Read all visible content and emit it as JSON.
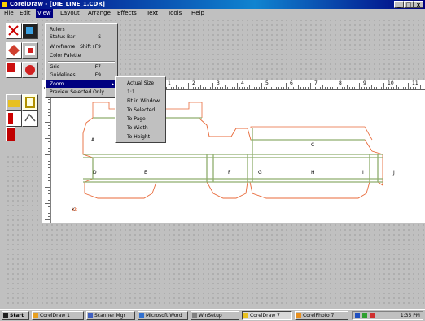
{
  "window": {
    "title": "CorelDraw - [DIE_LINE_1.CDR]",
    "min_label": "_",
    "max_label": "□",
    "close_label": "x"
  },
  "menubar": {
    "items": [
      "File",
      "Edit",
      "View",
      "Layout",
      "Arrange",
      "Effects",
      "Text",
      "Tools",
      "Help"
    ],
    "active_index": 2
  },
  "view_menu": {
    "items": [
      {
        "label": "Rulers",
        "shortcut": ""
      },
      {
        "label": "Status Bar",
        "shortcut": "S"
      },
      {
        "label": "Wireframe",
        "shortcut": "Shift+F9"
      },
      {
        "label": "Color Palette",
        "shortcut": ""
      },
      {
        "label": "Grid",
        "shortcut": "F7"
      },
      {
        "label": "Guidelines",
        "shortcut": "F9"
      },
      {
        "label": "Zoom",
        "shortcut": ""
      },
      {
        "label": "Preview Selected Only",
        "shortcut": ""
      }
    ],
    "highlighted_index": 6
  },
  "zoom_submenu": {
    "items": [
      "Actual Size",
      "1:1",
      "Fit in Window",
      "To Selected",
      "To Page",
      "To Width",
      "To Height"
    ]
  },
  "rulers": {
    "h_labels": [
      "1",
      "2",
      "3",
      "4",
      "5",
      "6",
      "7",
      "8",
      "9",
      "10",
      "11",
      "12"
    ]
  },
  "diagram": {
    "panel_labels": [
      "A",
      "B",
      "C",
      "D",
      "E",
      "F",
      "G",
      "H",
      "I",
      "J",
      "K"
    ],
    "note": "ab",
    "colors": {
      "cut": "#e86a3a",
      "fold": "#8fae6d"
    }
  },
  "taskbar": {
    "start_label": "Start",
    "buttons": [
      "CorelDraw 1",
      "Scanner Mgr",
      "Microsoft Word",
      "WinSetup",
      "CorelDraw 7",
      "CorelPhoto 7"
    ],
    "pressed_index": 4,
    "clock": "1:35 PM"
  }
}
